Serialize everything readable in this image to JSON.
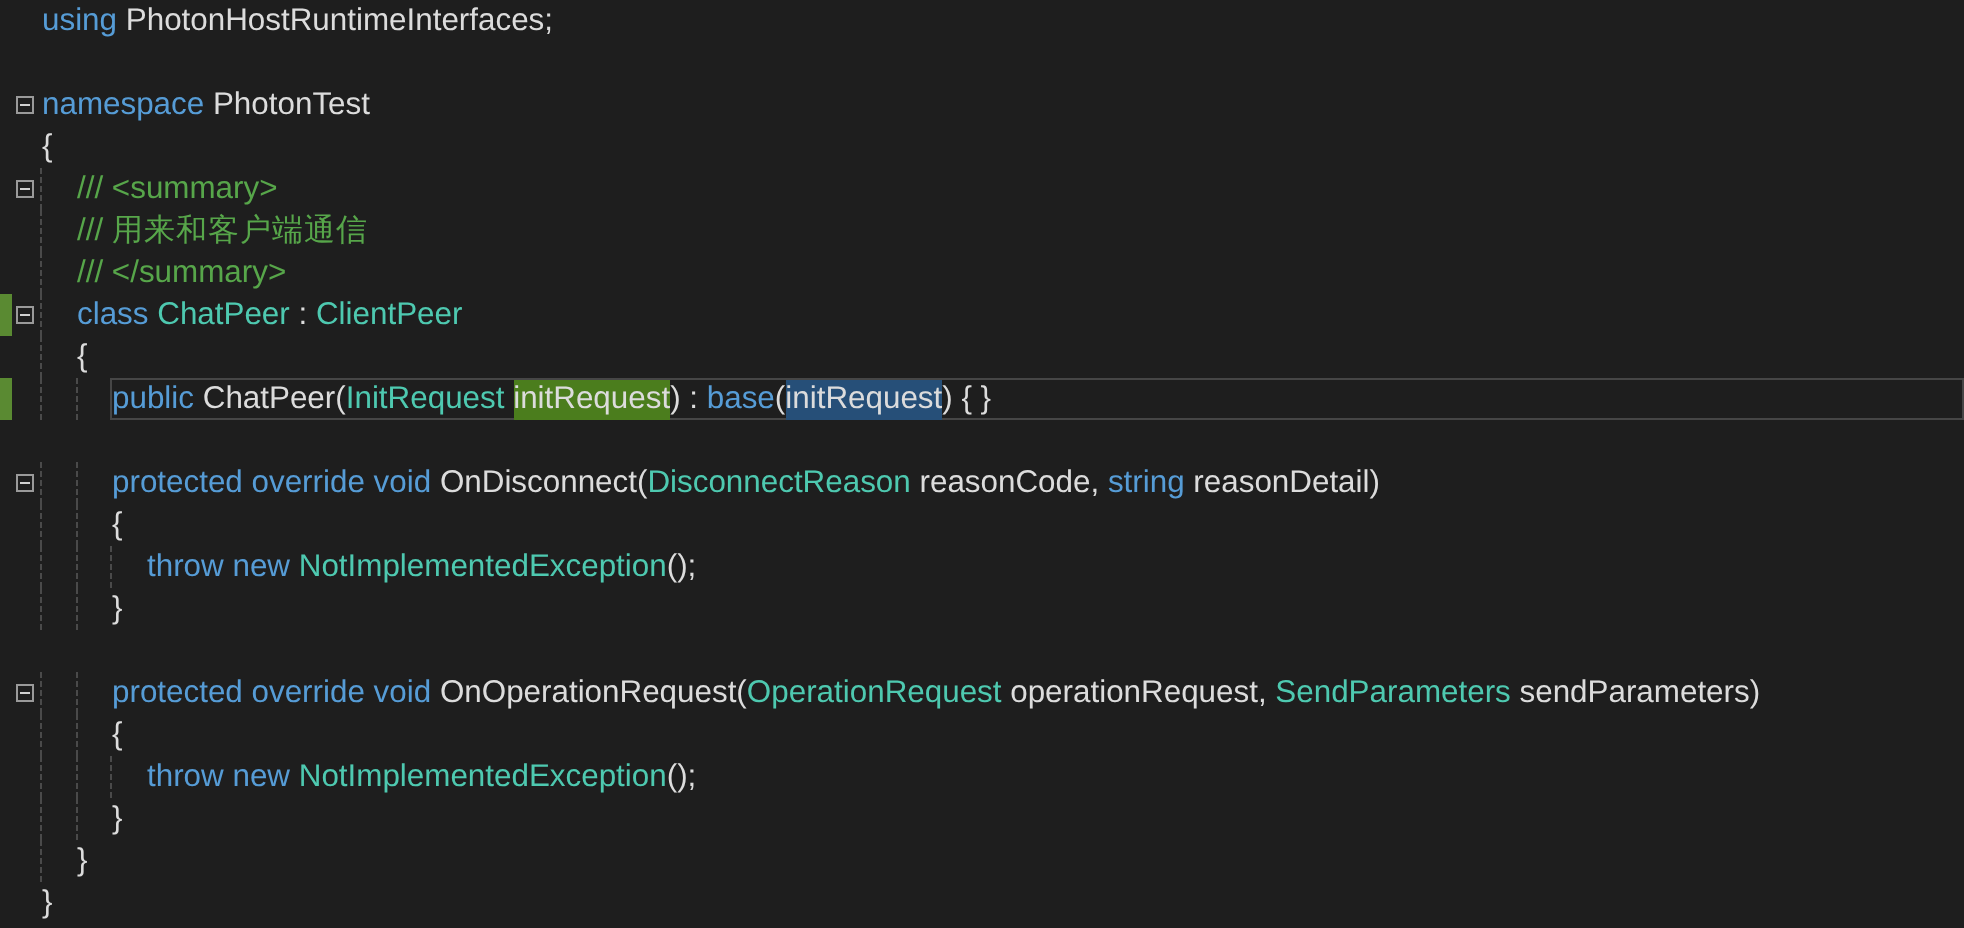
{
  "editor": {
    "lines": [
      {
        "kind": "code",
        "foldable": false,
        "changed": false,
        "current": false,
        "tokens": [
          {
            "text": "using ",
            "kind": "keyword"
          },
          {
            "text": "PhotonHostRuntimeInterfaces;",
            "kind": "plain"
          }
        ]
      },
      {
        "kind": "blank"
      },
      {
        "kind": "code",
        "foldable": true,
        "changed": false,
        "current": false,
        "tokens": [
          {
            "text": "namespace ",
            "kind": "keyword"
          },
          {
            "text": "PhotonTest",
            "kind": "plain"
          }
        ]
      },
      {
        "kind": "code",
        "foldable": false,
        "changed": false,
        "current": false,
        "tokens": [
          {
            "text": "{",
            "kind": "plain"
          }
        ],
        "children": [
          {
            "kind": "code",
            "foldable": true,
            "changed": false,
            "current": false,
            "tokens": [
              {
                "text": "/// <summary>",
                "kind": "comment"
              }
            ]
          },
          {
            "kind": "code",
            "foldable": false,
            "changed": false,
            "current": false,
            "tokens": [
              {
                "text": "/// 用来和客户端通信",
                "kind": "comment"
              }
            ]
          },
          {
            "kind": "code",
            "foldable": false,
            "changed": false,
            "current": false,
            "tokens": [
              {
                "text": "/// </summary>",
                "kind": "comment"
              }
            ]
          },
          {
            "kind": "code",
            "foldable": true,
            "changed": true,
            "current": false,
            "tokens": [
              {
                "text": "class ",
                "kind": "keyword"
              },
              {
                "text": "ChatPeer",
                "kind": "type"
              },
              {
                "text": " : ",
                "kind": "plain"
              },
              {
                "text": "ClientPeer",
                "kind": "type"
              }
            ]
          },
          {
            "kind": "code",
            "foldable": false,
            "changed": false,
            "current": false,
            "tokens": [
              {
                "text": "{",
                "kind": "plain"
              }
            ],
            "children": [
              {
                "kind": "code",
                "foldable": false,
                "changed": true,
                "current": true,
                "tokens": [
                  {
                    "text": "public ",
                    "kind": "keyword"
                  },
                  {
                    "text": "ChatPeer(",
                    "kind": "plain"
                  },
                  {
                    "text": "InitRequest ",
                    "kind": "type"
                  },
                  {
                    "text": "initRequest",
                    "kind": "plain",
                    "color": "#4b7d1d"
                  },
                  {
                    "text": ") : ",
                    "kind": "plain"
                  },
                  {
                    "text": "base",
                    "kind": "keyword"
                  },
                  {
                    "text": "(",
                    "kind": "plain"
                  },
                  {
                    "text": "initRequest",
                    "kind": "plain",
                    "color": "#264f78"
                  },
                  {
                    "text": ") { }",
                    "kind": "plain"
                  }
                ]
              },
              {
                "kind": "blank"
              },
              {
                "kind": "code",
                "foldable": true,
                "changed": false,
                "current": false,
                "tokens": [
                  {
                    "text": "protected override void ",
                    "kind": "keyword"
                  },
                  {
                    "text": "OnDisconnect(",
                    "kind": "plain"
                  },
                  {
                    "text": "DisconnectReason",
                    "kind": "type"
                  },
                  {
                    "text": " reasonCode, ",
                    "kind": "plain"
                  },
                  {
                    "text": "string",
                    "kind": "keyword"
                  },
                  {
                    "text": " reasonDetail)",
                    "kind": "plain"
                  }
                ]
              },
              {
                "kind": "code",
                "foldable": false,
                "changed": false,
                "current": false,
                "tokens": [
                  {
                    "text": "{",
                    "kind": "plain"
                  }
                ],
                "children": [
                  {
                    "kind": "code",
                    "foldable": false,
                    "changed": false,
                    "current": false,
                    "tokens": [
                      {
                        "text": "throw new ",
                        "kind": "keyword"
                      },
                      {
                        "text": "NotImplementedException",
                        "kind": "type"
                      },
                      {
                        "text": "();",
                        "kind": "plain"
                      }
                    ]
                  }
                ]
              },
              {
                "kind": "code",
                "foldable": false,
                "changed": false,
                "current": false,
                "tokens": [
                  {
                    "text": "}",
                    "kind": "plain"
                  }
                ]
              },
              {
                "kind": "blank"
              },
              {
                "kind": "code",
                "foldable": true,
                "changed": false,
                "current": false,
                "tokens": [
                  {
                    "text": "protected override void ",
                    "kind": "keyword"
                  },
                  {
                    "text": "OnOperationRequest(",
                    "kind": "plain"
                  },
                  {
                    "text": "OperationRequest",
                    "kind": "type"
                  },
                  {
                    "text": " operationRequest, ",
                    "kind": "plain"
                  },
                  {
                    "text": "SendParameters",
                    "kind": "type"
                  },
                  {
                    "text": " sendParameters)",
                    "kind": "plain"
                  }
                ]
              },
              {
                "kind": "code",
                "foldable": false,
                "changed": false,
                "current": false,
                "tokens": [
                  {
                    "text": "{",
                    "kind": "plain"
                  }
                ],
                "children": [
                  {
                    "kind": "code",
                    "foldable": false,
                    "changed": false,
                    "current": false,
                    "tokens": [
                      {
                        "text": "throw new ",
                        "kind": "keyword"
                      },
                      {
                        "text": "NotImplementedException",
                        "kind": "type"
                      },
                      {
                        "text": "();",
                        "kind": "plain"
                      }
                    ]
                  }
                ]
              },
              {
                "kind": "code",
                "foldable": false,
                "changed": false,
                "current": false,
                "tokens": [
                  {
                    "text": "}",
                    "kind": "plain"
                  }
                ]
              }
            ]
          },
          {
            "kind": "code",
            "foldable": false,
            "changed": false,
            "current": false,
            "tokens": [
              {
                "text": "}",
                "kind": "plain"
              }
            ]
          }
        ]
      },
      {
        "kind": "code",
        "foldable": false,
        "changed": false,
        "current": false,
        "tokens": [
          {
            "text": "}",
            "kind": "plain"
          }
        ]
      }
    ]
  }
}
